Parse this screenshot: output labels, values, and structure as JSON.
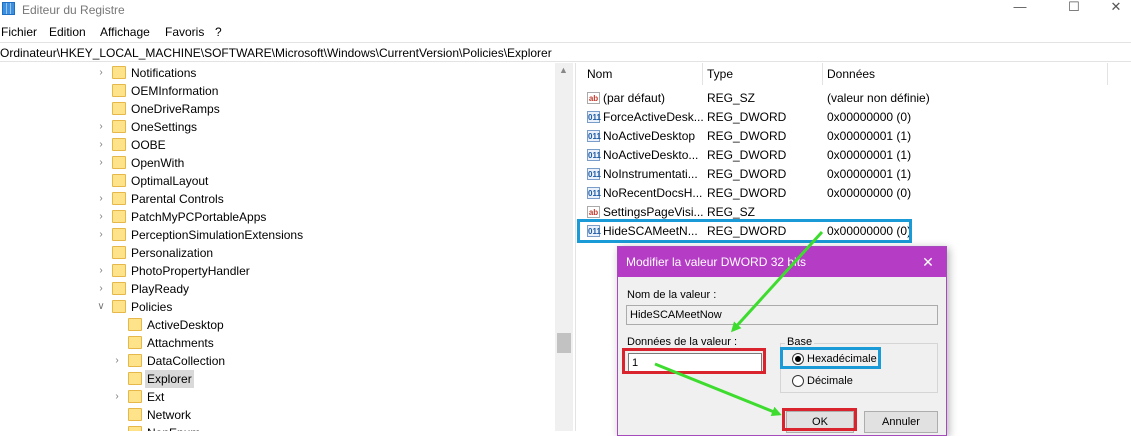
{
  "window": {
    "title": "Editeur du Registre",
    "minimize_glyph": "—",
    "maximize_glyph": "☐",
    "close_glyph": "✕",
    "icon": "registry-editor-icon"
  },
  "menu": [
    "Fichier",
    "Edition",
    "Affichage",
    "Favoris",
    "?"
  ],
  "address": "Ordinateur\\HKEY_LOCAL_MACHINE\\SOFTWARE\\Microsoft\\Windows\\CurrentVersion\\Policies\\Explorer",
  "tree": [
    {
      "label": "Notifications",
      "expandable": true,
      "level": 0
    },
    {
      "label": "OEMInformation",
      "expandable": false,
      "level": 0
    },
    {
      "label": "OneDriveRamps",
      "expandable": false,
      "level": 0
    },
    {
      "label": "OneSettings",
      "expandable": true,
      "level": 0
    },
    {
      "label": "OOBE",
      "expandable": true,
      "level": 0
    },
    {
      "label": "OpenWith",
      "expandable": true,
      "level": 0
    },
    {
      "label": "OptimalLayout",
      "expandable": false,
      "level": 0
    },
    {
      "label": "Parental Controls",
      "expandable": true,
      "level": 0
    },
    {
      "label": "PatchMyPCPortableApps",
      "expandable": true,
      "level": 0
    },
    {
      "label": "PerceptionSimulationExtensions",
      "expandable": true,
      "level": 0
    },
    {
      "label": "Personalization",
      "expandable": false,
      "level": 0
    },
    {
      "label": "PhotoPropertyHandler",
      "expandable": true,
      "level": 0
    },
    {
      "label": "PlayReady",
      "expandable": true,
      "level": 0
    },
    {
      "label": "Policies",
      "expandable": true,
      "expanded": true,
      "level": 0
    },
    {
      "label": "ActiveDesktop",
      "expandable": false,
      "level": 1
    },
    {
      "label": "Attachments",
      "expandable": false,
      "level": 1
    },
    {
      "label": "DataCollection",
      "expandable": true,
      "level": 1
    },
    {
      "label": "Explorer",
      "expandable": false,
      "level": 1,
      "selected": true
    },
    {
      "label": "Ext",
      "expandable": true,
      "level": 1
    },
    {
      "label": "Network",
      "expandable": false,
      "level": 1
    },
    {
      "label": "NonEnum",
      "expandable": false,
      "level": 1
    }
  ],
  "columns": {
    "name": "Nom",
    "type": "Type",
    "data": "Données"
  },
  "values": [
    {
      "icon": "ab",
      "kind": "sz",
      "name": "(par défaut)",
      "type": "REG_SZ",
      "data": "(valeur non définie)"
    },
    {
      "icon": "011",
      "kind": "dw",
      "name": "ForceActiveDesk...",
      "type": "REG_DWORD",
      "data": "0x00000000 (0)"
    },
    {
      "icon": "011",
      "kind": "dw",
      "name": "NoActiveDesktop",
      "type": "REG_DWORD",
      "data": "0x00000001 (1)"
    },
    {
      "icon": "011",
      "kind": "dw",
      "name": "NoActiveDeskto...",
      "type": "REG_DWORD",
      "data": "0x00000001 (1)"
    },
    {
      "icon": "011",
      "kind": "dw",
      "name": "NoInstrumentati...",
      "type": "REG_DWORD",
      "data": "0x00000001 (1)"
    },
    {
      "icon": "011",
      "kind": "dw",
      "name": "NoRecentDocsH...",
      "type": "REG_DWORD",
      "data": "0x00000000 (0)"
    },
    {
      "icon": "ab",
      "kind": "sz",
      "name": "SettingsPageVisi...",
      "type": "REG_SZ",
      "data": ""
    },
    {
      "icon": "011",
      "kind": "dw",
      "name": "HideSCAMeetN...",
      "type": "REG_DWORD",
      "data": "0x00000000 (0)"
    }
  ],
  "dialog": {
    "title": "Modifier la valeur DWORD 32 bits",
    "close_glyph": "✕",
    "value_name_label": "Nom de la valeur :",
    "value_name": "HideSCAMeetNow",
    "value_data_label": "Données de la valeur :",
    "value_data": "1",
    "base_label": "Base",
    "hex_label": "Hexadécimale",
    "dec_label": "Décimale",
    "ok_label": "OK",
    "cancel_label": "Annuler",
    "selected_base": "hex"
  },
  "annotations": {
    "highlight_blue": "#1a9ad6",
    "highlight_red": "#d9232d",
    "arrow_green": "#3ddc2f"
  }
}
